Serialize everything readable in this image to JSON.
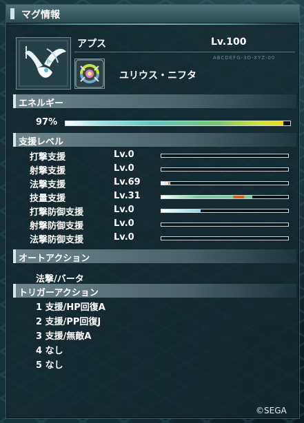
{
  "window": {
    "title": "マグ情報"
  },
  "mag": {
    "name": "アプス",
    "level": "Lv.100",
    "photon_blast": "ユリウス・ニフタ",
    "faint_code": "ABCDEFG-3D-XYZ-00"
  },
  "energy": {
    "header": "エネルギー",
    "percent_text": "97%",
    "percent": 97
  },
  "support": {
    "header": "支援レベル",
    "rows": [
      {
        "label": "打撃支援",
        "level": "Lv.0",
        "fill": 0,
        "color": "#ffffff"
      },
      {
        "label": "射撃支援",
        "level": "Lv.0",
        "fill": 0,
        "color": "#ffffff"
      },
      {
        "label": "法撃支援",
        "level": "Lv.69",
        "fill": 7,
        "color": "#e8e8e8",
        "accent": "#d6601a"
      },
      {
        "label": "技量支援",
        "level": "Lv.31",
        "fill": 72,
        "color": "#7cc9a2",
        "accent": "#d6601a"
      },
      {
        "label": "打撃防御支援",
        "level": "Lv.0",
        "fill": 31,
        "color": "#8fd8e6"
      },
      {
        "label": "射撃防御支援",
        "level": "Lv.0",
        "fill": 0,
        "color": "#ffffff"
      },
      {
        "label": "法撃防御支援",
        "level": "Lv.0",
        "fill": 0,
        "color": "#ffffff"
      }
    ]
  },
  "auto_action": {
    "header": "オートアクション",
    "value": "法撃/バータ"
  },
  "trigger": {
    "header": "トリガーアクション",
    "items": [
      "1 支援/HP回復A",
      "2 支援/PP回復J",
      "3 支援/無敵A",
      "4 なし",
      "5 なし"
    ]
  },
  "footer": {
    "copyright": "©SEGA"
  },
  "icons": {
    "mag_portrait": "winged-mag-icon",
    "photon_blast": "photon-blast-icon"
  }
}
